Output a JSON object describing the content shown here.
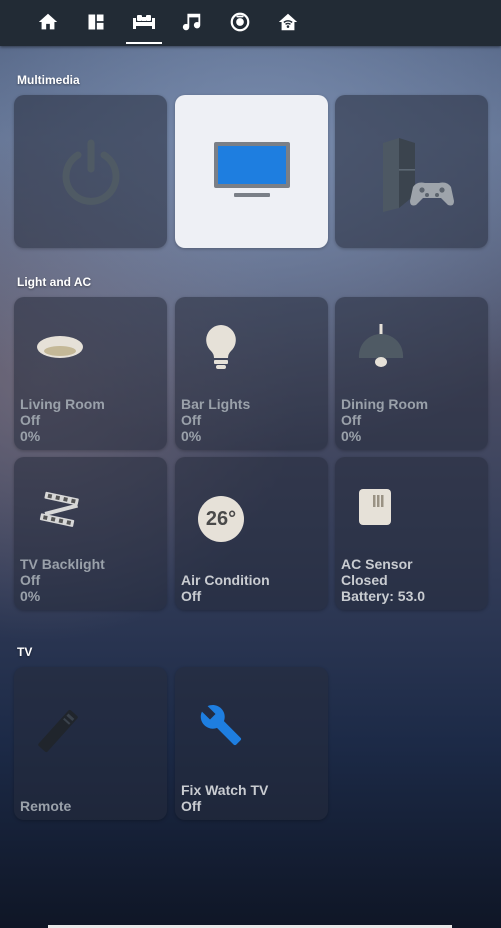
{
  "nav": {
    "tabs": [
      {
        "icon": "home-icon"
      },
      {
        "icon": "dashboard-icon"
      },
      {
        "icon": "sofa-icon",
        "active": true
      },
      {
        "icon": "music-icon"
      },
      {
        "icon": "robot-vacuum-icon"
      },
      {
        "icon": "home-wifi-icon"
      }
    ]
  },
  "sections": {
    "multimedia": {
      "title": "Multimedia"
    },
    "light_ac": {
      "title": "Light and AC"
    },
    "tv": {
      "title": "TV"
    }
  },
  "tiles": {
    "power": {
      "icon": "power-icon"
    },
    "television": {
      "icon": "television-icon",
      "selected": true
    },
    "playstation": {
      "icon": "playstation-icon"
    },
    "living_room": {
      "name": "Living Room",
      "state": "Off",
      "level": "0%"
    },
    "bar_lights": {
      "name": "Bar Lights",
      "state": "Off",
      "level": "0%"
    },
    "dining_room": {
      "name": "Dining Room",
      "state": "Off",
      "level": "0%"
    },
    "tv_backlight": {
      "name": "TV Backlight",
      "state": "Off",
      "level": "0%"
    },
    "air_condition": {
      "name": "Air Condition",
      "state": "Off",
      "temperature": "26°"
    },
    "ac_sensor": {
      "name": "AC Sensor",
      "state": "Closed",
      "battery": "Battery: 53.0"
    },
    "remote": {
      "name": "Remote"
    },
    "fix_watch_tv": {
      "name": "Fix Watch TV",
      "state": "Off"
    }
  },
  "colors": {
    "topbar": "#222b35",
    "accent_blue": "#1e7ee0",
    "icon_gray": "#4f5a64",
    "tile_text": "#9aa1aa",
    "selected_tile": "#eef0f5"
  }
}
